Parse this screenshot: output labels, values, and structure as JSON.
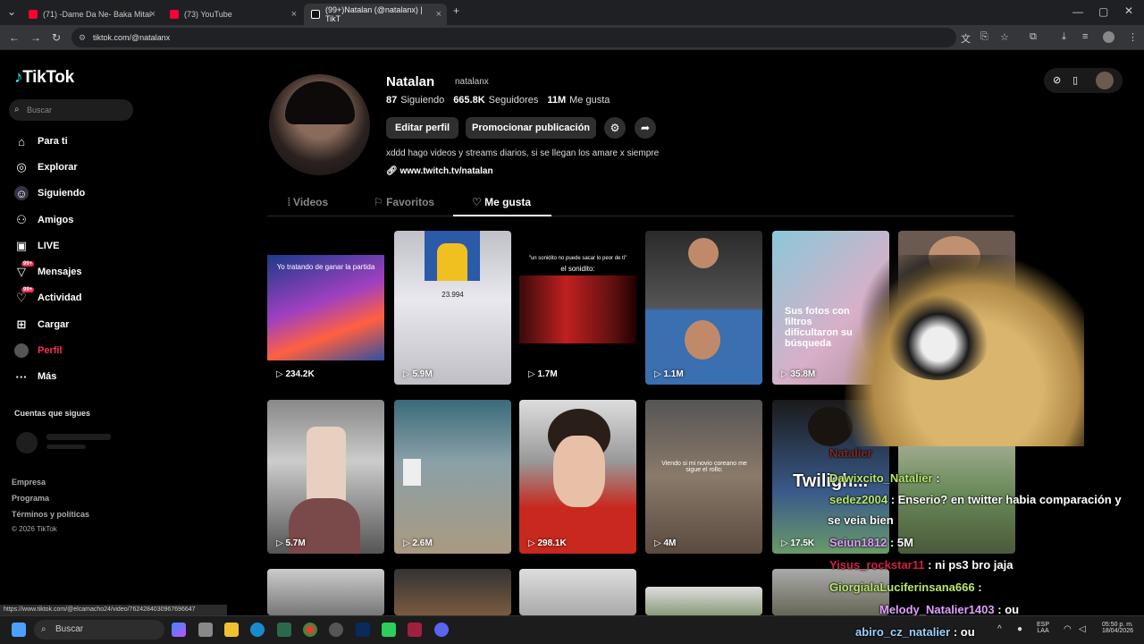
{
  "browser": {
    "tabs": [
      {
        "title": "(71) -Dame Da Ne- Baka Mitai",
        "color": "#ff0033"
      },
      {
        "title": "(73) YouTube",
        "color": "#ff0033"
      },
      {
        "title": "(99+)Natalan (@natalanx) | TikT",
        "color": "#ffffff"
      }
    ],
    "url": "tiktok.com/@natalanx",
    "new_tab": "+"
  },
  "sidebar": {
    "logo": "TikTok",
    "search_placeholder": "Buscar",
    "items": [
      {
        "label": "Para ti",
        "icon": "home-icon"
      },
      {
        "label": "Explorar",
        "icon": "compass-icon"
      },
      {
        "label": "Siguiendo",
        "icon": "following-icon"
      },
      {
        "label": "Amigos",
        "icon": "friends-icon"
      },
      {
        "label": "LIVE",
        "icon": "live-icon"
      },
      {
        "label": "Mensajes",
        "icon": "messages-icon",
        "badge": "99+"
      },
      {
        "label": "Actividad",
        "icon": "activity-icon",
        "badge": "99+"
      },
      {
        "label": "Cargar",
        "icon": "upload-icon"
      },
      {
        "label": "Perfil",
        "icon": "profile-icon",
        "active": true
      },
      {
        "label": "Más",
        "icon": "more-icon"
      }
    ],
    "following_heading": "Cuentas que sigues",
    "footer": [
      "Empresa",
      "Programa",
      "Términos y políticas",
      "© 2026 TikTok"
    ]
  },
  "profile": {
    "name": "Natalan",
    "handle": "natalanx",
    "following_count": "87",
    "following_label": "Siguiendo",
    "followers_count": "665.8K",
    "followers_label": "Seguidores",
    "likes_count": "11M",
    "likes_label": "Me gusta",
    "edit_button": "Editar perfil",
    "promote_button": "Promocionar publicación",
    "bio": "xddd hago videos y streams diarios, si se llegan los amare x siempre",
    "link": "www.twitch.tv/natalan",
    "tabs": [
      "Videos",
      "Favoritos",
      "Me gusta"
    ],
    "active_tab": "Me gusta"
  },
  "videos": [
    {
      "views": "234.2K",
      "caption": "Yo tratando de ganar la partida",
      "caption2": "..."
    },
    {
      "views": "5.9M",
      "caption": "23.994"
    },
    {
      "views": "1.7M",
      "caption": "\"un sonidito no puede sacar lo peor de ti\"",
      "caption2": "el sonidito:"
    },
    {
      "views": "1.1M",
      "caption": ""
    },
    {
      "views": "35.8M",
      "caption": "Sus fotos con filtros dificultaron su búsqueda"
    },
    {
      "views": "",
      "caption": ""
    },
    {
      "views": "5.7M",
      "caption": ""
    },
    {
      "views": "2.6M",
      "caption": ""
    },
    {
      "views": "298.1K",
      "caption": ""
    },
    {
      "views": "4M",
      "caption": "Viendo si mi novio coreano me sigue el rollo:"
    },
    {
      "views": "17.5K",
      "caption": ""
    },
    {
      "views": "",
      "caption": ""
    }
  ],
  "chat": [
    {
      "user": "Dawixcito_Natalier",
      "msg": ":"
    },
    {
      "user": "sedez2004",
      "msg": ": Enserio? en twitter habia comparación y"
    },
    {
      "user": "",
      "msg": "se veia bien"
    },
    {
      "user": "Seiun1812",
      "msg": ":"
    },
    {
      "user": "Yisus_rockstar11",
      "msg": ": ni ps3 bro jaja"
    },
    {
      "user": "GiorgialaLuciferinsana666",
      "msg": ":"
    },
    {
      "user": "Melody_Natalier1403",
      "msg": ": ou"
    },
    {
      "user": "abiro_cz_natalier",
      "msg": ": ou"
    }
  ],
  "chat_extra": {
    "partial_name": "Natalier",
    "partial_num": "5M",
    "twilight": "Twiligh..."
  },
  "status_url": "https://www.tiktok.com/@elcamacho24/video/7624284030967696647",
  "taskbar": {
    "search": "Buscar",
    "lang1": "ESP",
    "lang2": "LAA",
    "time": "05:50 p. m.",
    "date": "18/04/2026"
  }
}
